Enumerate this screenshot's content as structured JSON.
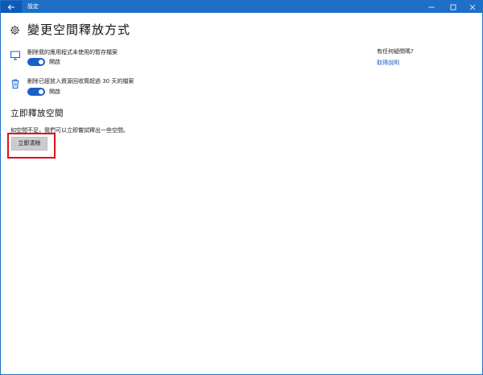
{
  "window": {
    "title": "設定"
  },
  "header": {
    "title": "變更空間釋放方式"
  },
  "settings": [
    {
      "label": "刪除我的應用程式未使用的暫存檔案",
      "state": "開啟",
      "icon": "monitor-icon"
    },
    {
      "label": "刪除已經放入資源回收筒超過 30 天的檔案",
      "state": "開啟",
      "icon": "trash-icon"
    }
  ],
  "free_now": {
    "title": "立即釋放空間",
    "description": "如空間不足，我們可以立即嘗試釋出一些空間。",
    "button_label": "立即清除"
  },
  "help": {
    "question": "有任何疑問嗎?",
    "link": "取得說明"
  },
  "colors": {
    "accent": "#1a5fc8",
    "titlebar": "#1f6fc7",
    "highlight": "#e0101a"
  }
}
